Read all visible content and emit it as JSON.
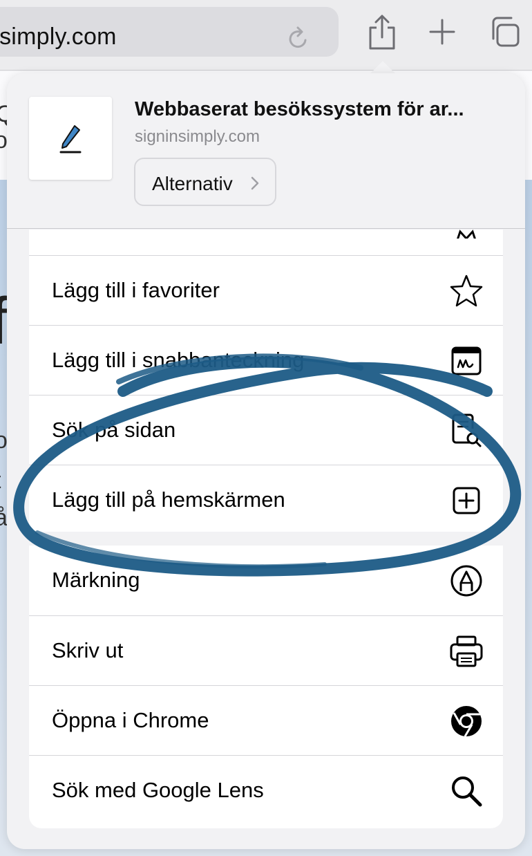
{
  "browser": {
    "url_text": "nsimply.com",
    "icons": [
      "reload-icon",
      "share-icon",
      "new-tab-icon",
      "tabs-icon"
    ]
  },
  "background": {
    "fragments": [
      "Q",
      "or",
      "f",
      "o",
      "t",
      "å"
    ]
  },
  "share_sheet": {
    "page_title": "Webbaserat besökssystem för ar...",
    "page_domain": "signinsimply.com",
    "options_label": "Alternativ",
    "items": [
      {
        "label": "Lägg till i favoriter",
        "icon": "star-icon"
      },
      {
        "label": "Lägg till i snabbanteckning",
        "icon": "quick-note-icon"
      },
      {
        "label": "Sök på sidan",
        "icon": "find-on-page-icon"
      },
      {
        "label": "Lägg till på hemskärmen",
        "icon": "add-to-home-icon"
      },
      {
        "label": "Märkning",
        "icon": "markup-icon"
      },
      {
        "label": "Skriv ut",
        "icon": "printer-icon"
      },
      {
        "label": "Öppna i Chrome",
        "icon": "chrome-icon"
      },
      {
        "label": "Sök med Google Lens",
        "icon": "google-lens-icon"
      }
    ]
  },
  "annotation": {
    "marker_color": "#1c5b86"
  }
}
